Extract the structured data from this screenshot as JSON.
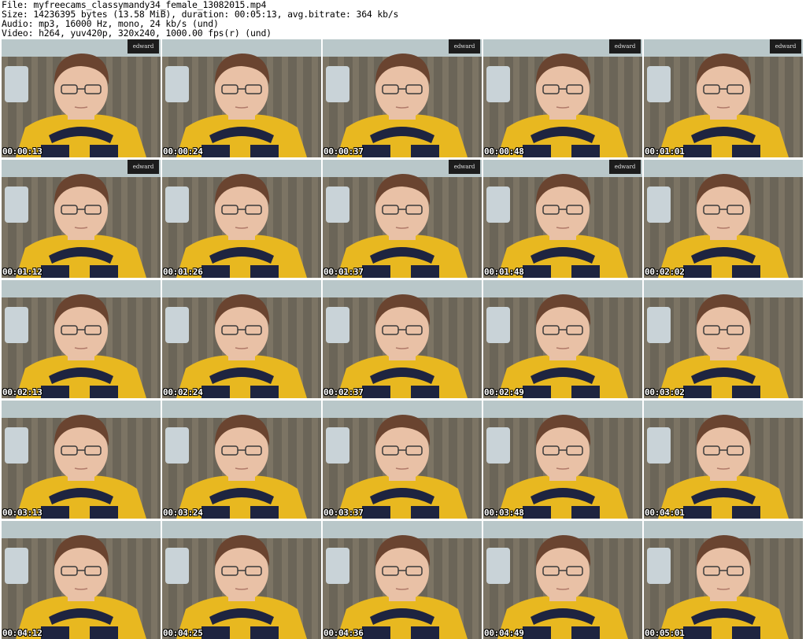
{
  "header": {
    "file": "File: myfreecams_classymandy34_female_13082015.mp4",
    "size": "Size: 14236395 bytes (13.58 MiB), duration: 00:05:13, avg.bitrate: 364 kb/s",
    "audio": "Audio: mp3, 16000 Hz, mono, 24 kb/s (und)",
    "video": "Video: h264, yuv420p, 320x240, 1000.00 fps(r) (und)"
  },
  "colors": {
    "wall": "#b9c7c9",
    "couch": "#6b6558",
    "shirt_yellow": "#e8b820",
    "shirt_navy": "#1e2440",
    "skin": "#e9c1a6",
    "hair": "#6a4430"
  },
  "thumbnails": [
    {
      "time": "00:00:13",
      "sign": true
    },
    {
      "time": "00:00:24",
      "sign": false
    },
    {
      "time": "00:00:37",
      "sign": true
    },
    {
      "time": "00:00:48",
      "sign": true
    },
    {
      "time": "00:01:01",
      "sign": true
    },
    {
      "time": "00:01:12",
      "sign": true
    },
    {
      "time": "00:01:26",
      "sign": false
    },
    {
      "time": "00:01:37",
      "sign": true
    },
    {
      "time": "00:01:48",
      "sign": true
    },
    {
      "time": "00:02:02",
      "sign": false
    },
    {
      "time": "00:02:13",
      "sign": false
    },
    {
      "time": "00:02:24",
      "sign": false
    },
    {
      "time": "00:02:37",
      "sign": false
    },
    {
      "time": "00:02:49",
      "sign": false
    },
    {
      "time": "00:03:02",
      "sign": false
    },
    {
      "time": "00:03:13",
      "sign": false
    },
    {
      "time": "00:03:24",
      "sign": false
    },
    {
      "time": "00:03:37",
      "sign": false
    },
    {
      "time": "00:03:48",
      "sign": false
    },
    {
      "time": "00:04:01",
      "sign": false
    },
    {
      "time": "00:04:12",
      "sign": false
    },
    {
      "time": "00:04:25",
      "sign": false
    },
    {
      "time": "00:04:36",
      "sign": false
    },
    {
      "time": "00:04:49",
      "sign": false
    },
    {
      "time": "00:05:01",
      "sign": false
    }
  ],
  "sign_text": "edward"
}
